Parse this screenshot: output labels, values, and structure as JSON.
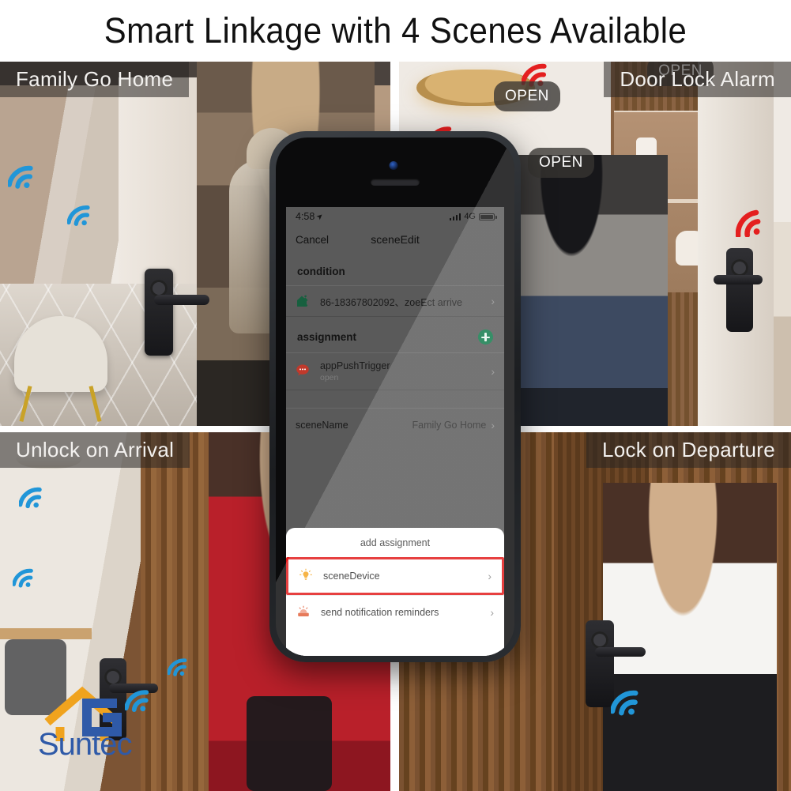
{
  "headline": "Smart Linkage with 4 Scenes Available",
  "brand": {
    "name": "Suntec",
    "logo_letter": "G",
    "roof_color": "#f0a31e",
    "text_color": "#2f5aa8"
  },
  "scenes": [
    {
      "id": "family-go-home",
      "caption": "Family Go Home",
      "position": "top-left"
    },
    {
      "id": "door-lock-alarm",
      "caption": "Door Lock Alarm",
      "position": "top-right"
    },
    {
      "id": "unlock-on-arrival",
      "caption": "Unlock on Arrival",
      "position": "bottom-left"
    },
    {
      "id": "lock-on-departure",
      "caption": "Lock on Departure",
      "position": "bottom-right"
    }
  ],
  "alert_badges": [
    {
      "label": "OPEN"
    },
    {
      "label": "OPEN"
    },
    {
      "label": "OPEN"
    }
  ],
  "signal_colors": {
    "wifi_blue": "#2196d8",
    "alarm_red": "#e41f1f"
  },
  "phone": {
    "status_bar": {
      "time": "4:58",
      "network": "4G",
      "location_arrow": "➤"
    },
    "nav": {
      "cancel": "Cancel",
      "title": "sceneEdit"
    },
    "condition": {
      "header": "condition",
      "rows": [
        {
          "icon": "home-person-arrive-icon",
          "title": "86-18367802092、zoeEct arrive",
          "subtitle": "",
          "chevron": "›"
        }
      ]
    },
    "assignment": {
      "header": "assignment",
      "add_icon": "plus-circle-icon",
      "rows": [
        {
          "icon": "chat-bubble-icon",
          "title": "appPushTrigger",
          "subtitle": "open",
          "chevron": "›"
        }
      ]
    },
    "scene_name": {
      "label": "sceneName",
      "value": "Family Go Home",
      "chevron": "›"
    },
    "action_sheet": {
      "title": "add assignment",
      "rows": [
        {
          "icon": "bulb-icon",
          "label": "sceneDevice",
          "chevron": "›",
          "highlighted": true
        },
        {
          "icon": "notification-icon",
          "label": "send notification reminders",
          "chevron": "›",
          "highlighted": false
        }
      ]
    }
  }
}
